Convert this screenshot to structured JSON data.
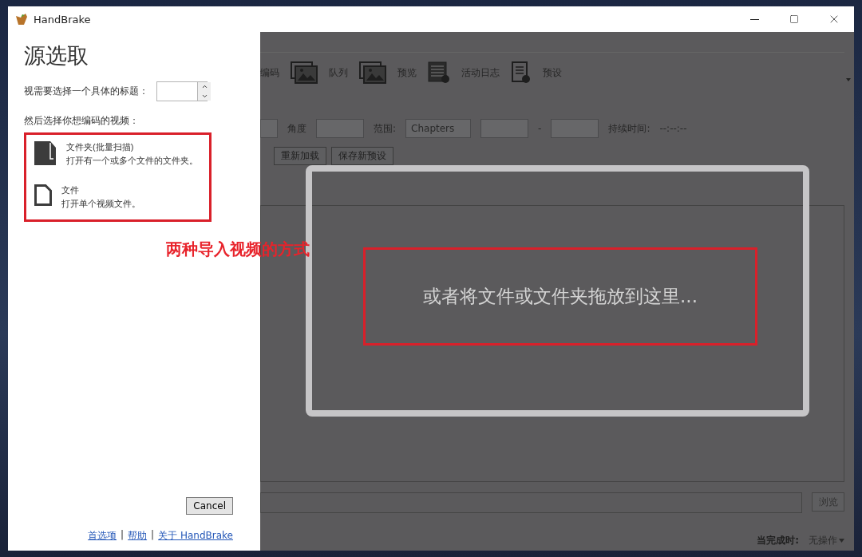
{
  "window": {
    "title": "HandBrake"
  },
  "source_panel": {
    "heading": "源选取",
    "title_prompt": "视需要选择一个具体的标题：",
    "video_prompt": "然后选择你想编码的视频：",
    "options": [
      {
        "kind": "folder",
        "name": "文件夹(批量扫描)",
        "description": "打开有一个或多个文件的文件夹。"
      },
      {
        "kind": "file",
        "name": "文件",
        "description": "打开单个视频文件。"
      }
    ],
    "cancel": "Cancel",
    "links": [
      {
        "kind": "link",
        "label": "首选项"
      },
      {
        "kind": "separator",
        "label": "|"
      },
      {
        "kind": "link",
        "label": "帮助"
      },
      {
        "kind": "separator",
        "label": "|"
      },
      {
        "kind": "link",
        "label": "关于 HandBrake"
      }
    ]
  },
  "toolbar": [
    {
      "kind": "text",
      "label": "编码"
    },
    {
      "kind": "queue",
      "label": "队列"
    },
    {
      "kind": "preview",
      "label": "预览"
    },
    {
      "kind": "log",
      "label": "活动日志"
    },
    {
      "kind": "presets",
      "label": "预设"
    }
  ],
  "source_settings": [
    {
      "kind": "dropdown"
    },
    {
      "kind": "label",
      "label": "角度"
    },
    {
      "kind": "dropdown"
    },
    {
      "kind": "label",
      "label": "范围:"
    },
    {
      "kind": "dropdown",
      "label": "Chapters"
    },
    {
      "kind": "dropdown"
    },
    {
      "kind": "label",
      "label": "-"
    },
    {
      "kind": "dropdown"
    },
    {
      "kind": "label",
      "label": "持续时间:"
    },
    {
      "kind": "label",
      "label": "--:--:--"
    }
  ],
  "actions": [
    "重新加载",
    "保存新预设"
  ],
  "drop_hint": "或者将文件或文件夹拖放到这里...",
  "destination": {
    "browse": "浏览"
  },
  "status": {
    "label": "当完成时:",
    "action": "无操作"
  },
  "annotation": "两种导入视频的方式"
}
